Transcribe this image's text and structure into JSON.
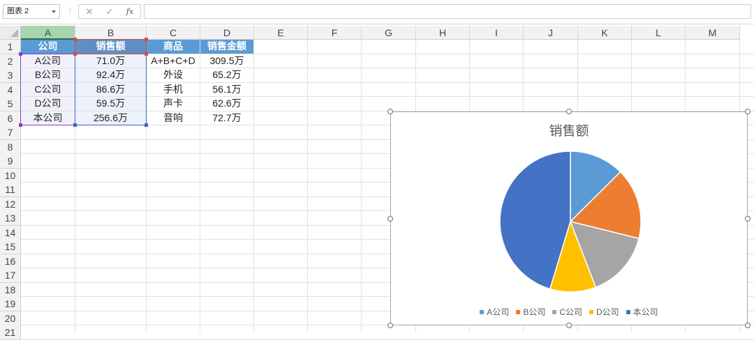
{
  "formula_bar": {
    "name_box": "图表 2",
    "dots": "⋮",
    "cancel_glyph": "✕",
    "enter_glyph": "✓",
    "fx_label": "fx",
    "formula": ""
  },
  "sheet": {
    "columns": [
      "A",
      "B",
      "C",
      "D",
      "E",
      "F",
      "G",
      "H",
      "I",
      "J",
      "K",
      "L",
      "M"
    ],
    "rows": [
      "1",
      "2",
      "3",
      "4",
      "5",
      "6",
      "7",
      "8",
      "9",
      "10",
      "11",
      "12",
      "13",
      "14",
      "15",
      "16",
      "17",
      "18",
      "19",
      "20",
      "21"
    ],
    "table": {
      "headers": [
        "公司",
        "销售额",
        "商品",
        "销售金额"
      ],
      "rows": [
        [
          "A公司",
          "71.0万",
          "A+B+C+D",
          "309.5万"
        ],
        [
          "B公司",
          "92.4万",
          "外设",
          "65.2万"
        ],
        [
          "C公司",
          "86.6万",
          "手机",
          "56.1万"
        ],
        [
          "D公司",
          "59.5万",
          "声卡",
          "62.6万"
        ],
        [
          "本公司",
          "256.6万",
          "音响",
          "72.7万"
        ]
      ]
    }
  },
  "chart": {
    "title": "销售额",
    "colors": [
      "#5b9bd5",
      "#ed7d31",
      "#a5a5a5",
      "#ffc000",
      "#4472c4"
    ]
  },
  "chart_data": {
    "type": "pie",
    "title": "销售额",
    "categories": [
      "A公司",
      "B公司",
      "C公司",
      "D公司",
      "本公司"
    ],
    "values": [
      71.0,
      92.4,
      86.6,
      59.5,
      256.6
    ],
    "legend": "bottom"
  }
}
